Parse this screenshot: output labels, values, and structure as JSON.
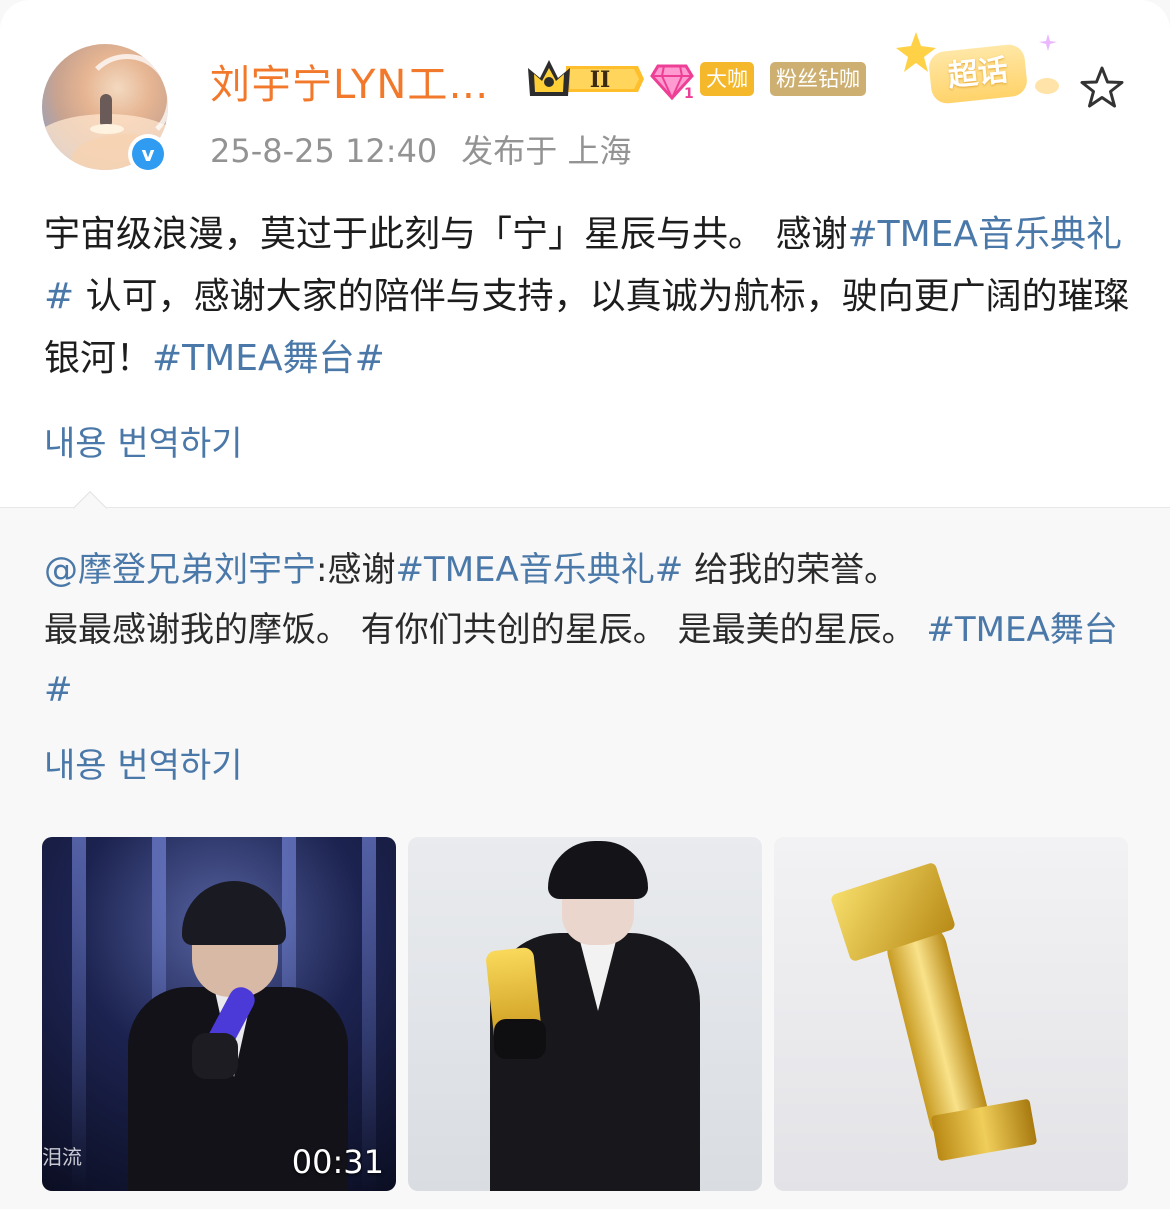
{
  "post": {
    "author": "刘宇宁LYN工…",
    "badges": {
      "rank": "II",
      "daka": "大咖",
      "fensi": "粉丝钻咖",
      "chaohua": "超话"
    },
    "timestamp": "25-8-25 12:40",
    "location": "发布于 上海",
    "text_plain_1": "宇宙级浪漫，莫过于此刻与「宁」星辰与共。 感谢",
    "tag_tmea_1": "#TMEA音乐典礼#",
    "text_plain_2": " 认可，感谢大家的陪伴与支持，以真诚为航标，驶向更广阔的璀璨银河！",
    "tag_stage_1": "#TMEA舞台#",
    "translate_label": "내용 번역하기"
  },
  "repost": {
    "mention": "@摩登兄弟刘宇宁",
    "text_1": ":感谢",
    "tag_tmea": "#TMEA音乐典礼#",
    "text_2": " 给我的荣誉。",
    "text_3": "最最感谢我的摩饭。 有你们共创的星辰。 是最美的星辰。 ",
    "tag_stage": "#TMEA舞台#",
    "translate_label": "내용 번역하기",
    "media": [
      {
        "kind": "video",
        "duration": "00:31",
        "corner_text": "泪流"
      },
      {
        "kind": "image"
      },
      {
        "kind": "image"
      }
    ]
  },
  "icons": {
    "verified": "verified-badge-icon",
    "favorite": "star-outline-icon"
  },
  "colors": {
    "author": "#f2792b",
    "link": "#4a78a8",
    "meta": "#939393",
    "verified": "#2f9bf1"
  }
}
